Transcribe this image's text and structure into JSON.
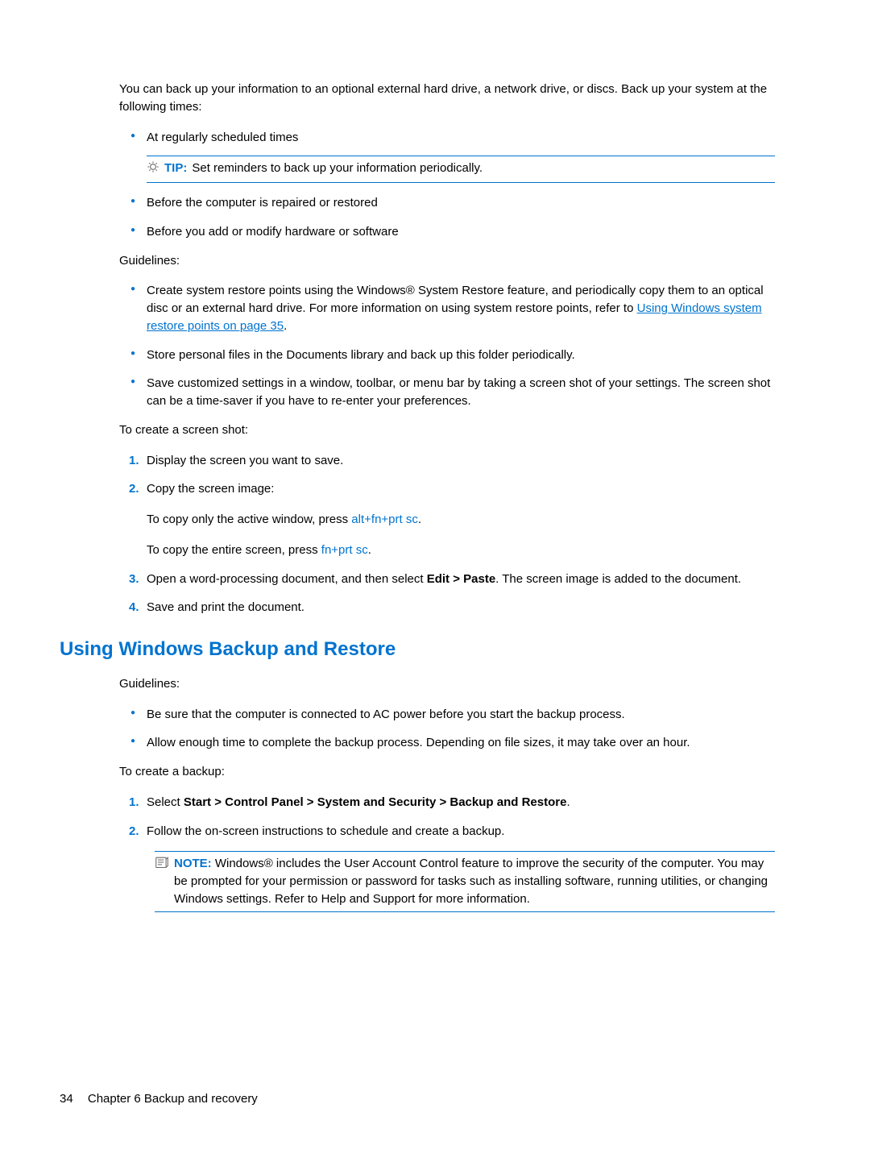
{
  "intro": "You can back up your information to an optional external hard drive, a network drive, or discs. Back up your system at the following times:",
  "bullets1": {
    "b1": "At regularly scheduled times",
    "tip_label": "TIP:",
    "tip_text": "Set reminders to back up your information periodically.",
    "b2": "Before the computer is repaired or restored",
    "b3": "Before you add or modify hardware or software"
  },
  "guidelines_label": "Guidelines:",
  "bullets2": {
    "b1a": "Create system restore points using the Windows® System Restore feature, and periodically copy them to an optical disc or an external hard drive. For more information on using system restore points, refer to ",
    "b1_link": "Using Windows system restore points on page 35",
    "b1b": ".",
    "b2": "Store personal files in the Documents library and back up this folder periodically.",
    "b3": "Save customized settings in a window, toolbar, or menu bar by taking a screen shot of your settings. The screen shot can be a time-saver if you have to re-enter your preferences."
  },
  "screenshot_intro": "To create a screen shot:",
  "steps1": {
    "s1": "Display the screen you want to save.",
    "s2": "Copy the screen image:",
    "s2_sub1a": "To copy only the active window, press ",
    "s2_sub1_key": "alt+fn+prt sc",
    "s2_sub1b": ".",
    "s2_sub2a": "To copy the entire screen, press ",
    "s2_sub2_key": "fn+prt sc",
    "s2_sub2b": ".",
    "s3a": "Open a word-processing document, and then select ",
    "s3_bold": "Edit > Paste",
    "s3b": ". The screen image is added to the document.",
    "s4": "Save and print the document."
  },
  "section_heading": "Using Windows Backup and Restore",
  "guidelines2_label": "Guidelines:",
  "bullets3": {
    "b1": "Be sure that the computer is connected to AC power before you start the backup process.",
    "b2": "Allow enough time to complete the backup process. Depending on file sizes, it may take over an hour."
  },
  "backup_intro": "To create a backup:",
  "steps2": {
    "s1a": "Select ",
    "s1_bold": "Start > Control Panel > System and Security > Backup and Restore",
    "s1b": ".",
    "s2": "Follow the on-screen instructions to schedule and create a backup."
  },
  "note": {
    "label": "NOTE:",
    "text": "Windows® includes the User Account Control feature to improve the security of the computer. You may be prompted for your permission or password for tasks such as installing software, running utilities, or changing Windows settings. Refer to Help and Support for more information."
  },
  "footer": {
    "page": "34",
    "chapter": "Chapter 6   Backup and recovery"
  }
}
